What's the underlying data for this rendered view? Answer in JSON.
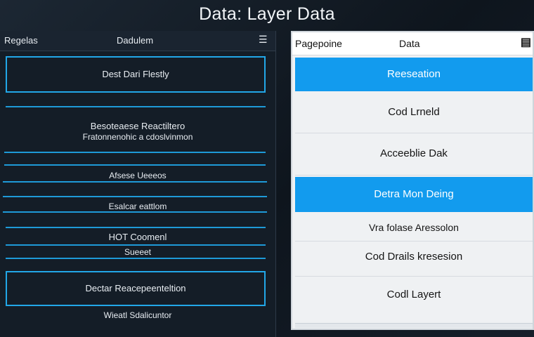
{
  "window": {
    "title": "Data: Layer Data"
  },
  "left_panel": {
    "header": {
      "col1": "Regelas",
      "col2": "Dadulem",
      "menu_icon": "list-icon"
    },
    "top_box_label": "Dest Dari Flestly",
    "section_title": "Besoteaese Reactiltero",
    "section_subtitle": "Fratonnenohic a cdoslvinmon",
    "items": [
      "Afsese Ueeeos",
      "Esalcar eattlom",
      "HOT Coomenl",
      "Sueeet"
    ],
    "bottom_box_label": "Dectar Reacepeenteltion",
    "footer_text": "Wieatl Sdalicuntor"
  },
  "right_panel": {
    "header": {
      "col1": "Pagepoine",
      "col2": "Data",
      "icon": "chart-icon"
    },
    "rows": [
      {
        "label": "Reeseation",
        "active": true
      },
      {
        "label": "Cod Lrneld",
        "active": false
      },
      {
        "label": "Acceeblie Dak",
        "active": false
      },
      {
        "label": "Detra Mon Deing",
        "active": true
      },
      {
        "label": "Vra folase Aressolon",
        "active": false
      },
      {
        "label": "Cod Drails kresesion",
        "active": false
      },
      {
        "label": "Codl Layert",
        "active": false
      }
    ]
  },
  "colors": {
    "accent": "#129bee",
    "line": "#1e9ad8",
    "panel_dark": "#141d27"
  }
}
